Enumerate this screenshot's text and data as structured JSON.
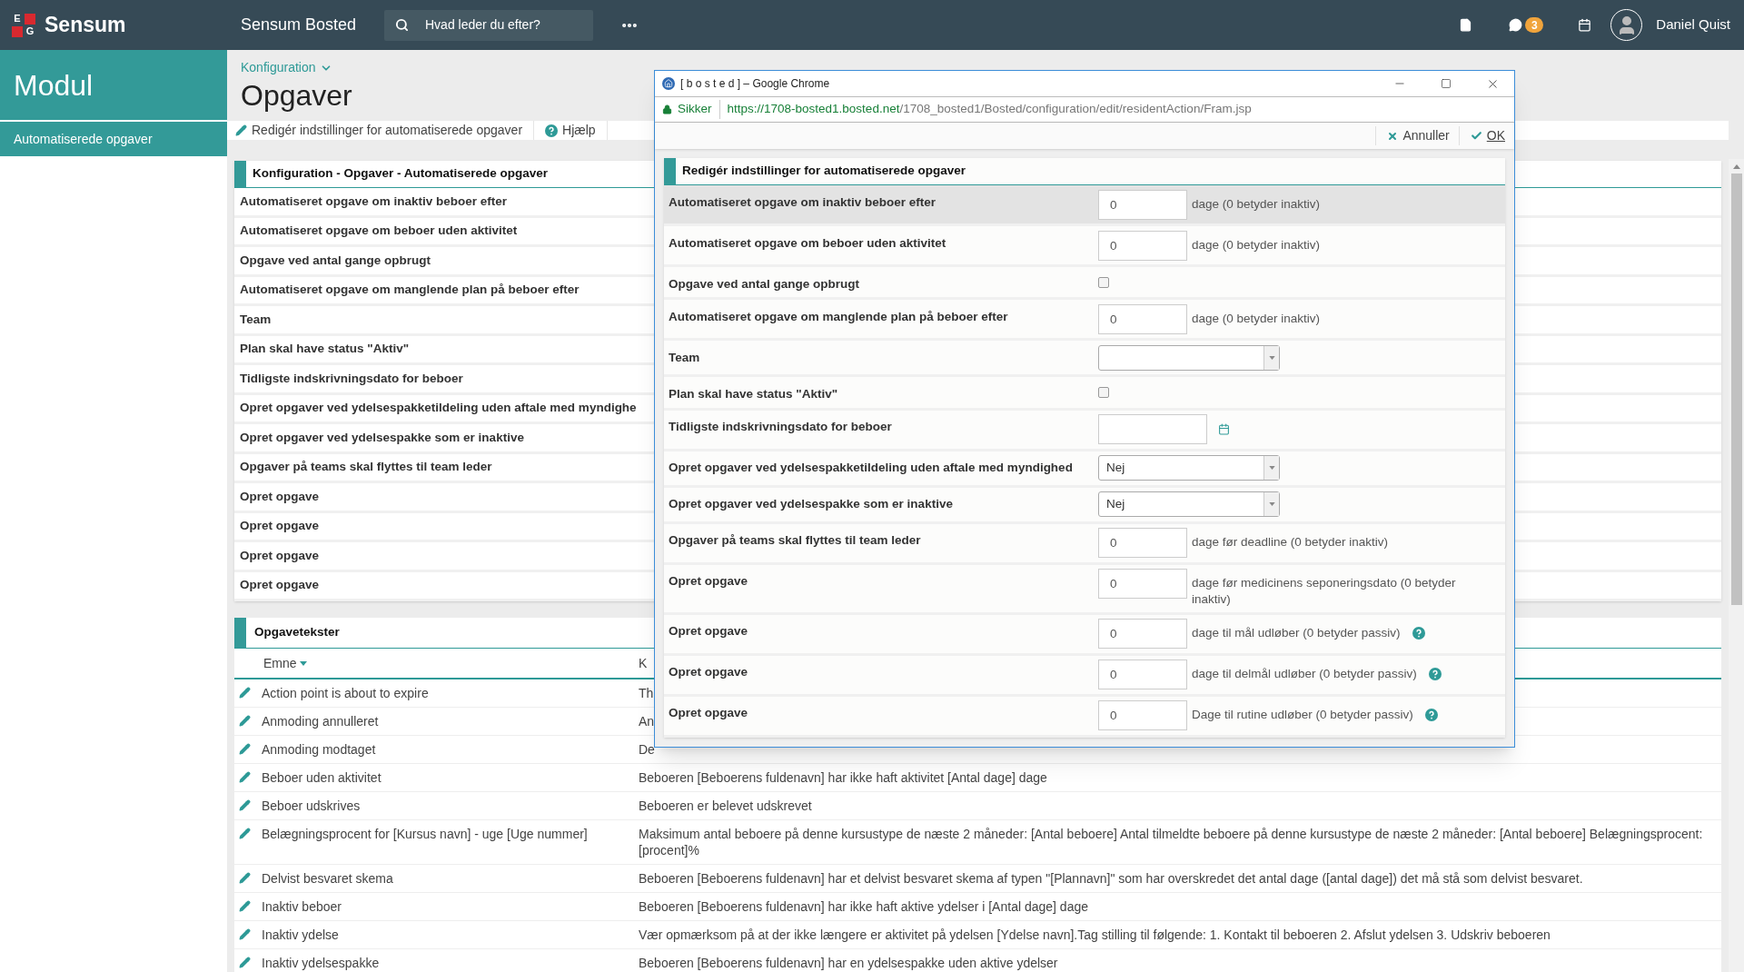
{
  "topbar": {
    "brand_mark": [
      "E",
      "G"
    ],
    "brand": "Sensum",
    "app_name": "Sensum Bosted",
    "search": {
      "placeholder": "Hvad leder du efter?"
    },
    "messages_badge": "3",
    "user": "Daniel Quist"
  },
  "sidebar": {
    "title": "Modul",
    "items": [
      {
        "label": "Automatiserede opgaver",
        "selected": true
      }
    ]
  },
  "page": {
    "breadcrumb": "Konfiguration",
    "title": "Opgaver",
    "toolbar": [
      {
        "kind": "edit",
        "label": "Redigér indstillinger for automatiserede opgaver"
      },
      {
        "kind": "help",
        "label": "Hjælp"
      }
    ]
  },
  "config_panel": {
    "title": "Konfiguration - Opgaver - Automatiserede opgaver",
    "rows": [
      "Automatiseret opgave om inaktiv beboer efter",
      "Automatiseret opgave om beboer uden aktivitet",
      "Opgave ved antal gange opbrugt",
      "Automatiseret opgave om manglende plan på beboer efter",
      "Team",
      "Plan skal have status \"Aktiv\"",
      "Tidligste indskrivningsdato for beboer",
      "Opret opgaver ved ydelsespakketildeling uden aftale med myndighe",
      "Opret opgaver ved ydelsespakke som er inaktive",
      "Opgaver på teams skal flyttes til team leder",
      "Opret opgave",
      "Opret opgave",
      "Opret opgave",
      "Opret opgave"
    ]
  },
  "texts_panel": {
    "title": "Opgavetekster",
    "columns": [
      {
        "label": "Emne",
        "sorted": true
      },
      {
        "label": "K",
        "sorted": false
      }
    ],
    "rows": [
      {
        "subject": "Action point is about to expire",
        "text": "Th"
      },
      {
        "subject": "Anmoding annulleret",
        "text": "An"
      },
      {
        "subject": "Anmoding modtaget",
        "text": "De"
      },
      {
        "subject": "Beboer uden aktivitet",
        "text": "Beboeren [Beboerens fuldenavn] har ikke haft aktivitet [Antal dage] dage"
      },
      {
        "subject": "Beboer udskrives",
        "text": "Beboeren er belevet udskrevet"
      },
      {
        "subject": "Belægningsprocent for [Kursus navn] - uge [Uge nummer]",
        "text": "Maksimum antal beboere på denne kursustype de næste 2 måneder: [Antal beboere] Antal tilmeldte beboere på denne kursustype de næste 2 måneder: [Antal beboere] Belægningsprocent: [procent]%"
      },
      {
        "subject": "Delvist besvaret skema",
        "text": "Beboeren [Beboerens fuldenavn] har et delvist besvaret skema af typen \"[Plannavn]\" som har overskredet det antal dage ([antal dage]) det må stå som delvist besvaret."
      },
      {
        "subject": "Inaktiv beboer",
        "text": "Beboeren [Beboerens fuldenavn] har ikke haft aktive ydelser i [Antal dage] dage"
      },
      {
        "subject": "Inaktiv ydelse",
        "text": "Vær opmærksom på at der ikke længere er aktivitet på ydelsen [Ydelse navn].Tag stilling til følgende: 1. Kontakt til beboeren 2. Afslut ydelsen 3. Udskriv beboeren"
      },
      {
        "subject": "Inaktiv ydelsespakke",
        "text": "Beboeren [Beboerens fuldenavn] har en ydelsespakke uden aktive ydelser"
      }
    ]
  },
  "popup": {
    "window_title": "[ b o s t e d ] – Google Chrome",
    "secure_label": "Sikker",
    "url_host": "https://1708-bosted1.bosted.net",
    "url_path": "/1708_bosted1/Bosted/configuration/edit/residentAction/Fram.jsp",
    "actions": [
      {
        "kind": "cancel",
        "label": "Annuller"
      },
      {
        "kind": "ok",
        "label": "OK"
      }
    ],
    "form_title": "Redigér indstillinger for automatiserede opgaver",
    "rows": [
      {
        "kind": "number",
        "label": "Automatiseret opgave om inaktiv beboer efter",
        "value": "0",
        "suffix": "dage (0 betyder inaktiv)",
        "help": false,
        "highlighted": true
      },
      {
        "kind": "number",
        "label": "Automatiseret opgave om beboer uden aktivitet",
        "value": "0",
        "suffix": "dage (0 betyder inaktiv)",
        "help": false,
        "highlighted": false
      },
      {
        "kind": "checkbox",
        "label": "Opgave ved antal gange opbrugt",
        "checked": false,
        "highlighted": false
      },
      {
        "kind": "number",
        "label": "Automatiseret opgave om manglende plan på beboer efter",
        "value": "0",
        "suffix": "dage (0 betyder inaktiv)",
        "help": false,
        "highlighted": false
      },
      {
        "kind": "select",
        "label": "Team",
        "highlighted": false
      },
      {
        "kind": "checkbox",
        "label": "Plan skal have status \"Aktiv\"",
        "checked": false,
        "highlighted": false
      },
      {
        "kind": "date",
        "label": "Tidligste indskrivningsdato for beboer",
        "highlighted": false
      },
      {
        "kind": "select",
        "label": "Opret opgaver ved ydelsespakketildeling uden aftale med myndighed",
        "value": "Nej",
        "highlighted": false
      },
      {
        "kind": "select",
        "label": "Opret opgaver ved ydelsespakke som er inaktive",
        "value": "Nej",
        "highlighted": false
      },
      {
        "kind": "number",
        "label": "Opgaver på teams skal flyttes til team leder",
        "value": "0",
        "suffix": "dage før deadline (0 betyder inaktiv)",
        "help": false,
        "highlighted": false
      },
      {
        "kind": "number",
        "label": "Opret opgave",
        "value": "0",
        "suffix": "dage før medicinens seponeringsdato (0 betyder inaktiv)",
        "help": false,
        "highlighted": false
      },
      {
        "kind": "number",
        "label": "Opret opgave",
        "value": "0",
        "suffix": "dage til mål udløber (0 betyder passiv)",
        "help": true,
        "highlighted": false
      },
      {
        "kind": "number",
        "label": "Opret opgave",
        "value": "0",
        "suffix": "dage til delmål udløber (0 betyder passiv)",
        "help": true,
        "highlighted": false
      },
      {
        "kind": "number",
        "label": "Opret opgave",
        "value": "0",
        "suffix": "Dage til rutine udløber (0 betyder passiv)",
        "help": true,
        "highlighted": false
      }
    ]
  }
}
